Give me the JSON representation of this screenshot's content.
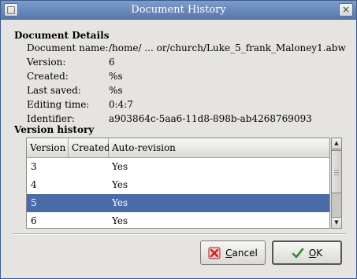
{
  "window": {
    "title": "Document History",
    "left_button": "□",
    "close_button": "×"
  },
  "details": {
    "heading": "Document Details",
    "rows": [
      {
        "label": "Document name:",
        "value": "/home/ ... or/church/Luke_5_frank_Maloney1.abw"
      },
      {
        "label": "Version:",
        "value": "6"
      },
      {
        "label": "Created:",
        "value": "%s"
      },
      {
        "label": "Last saved:",
        "value": "%s"
      },
      {
        "label": "Editing time:",
        "value": "0:4:7"
      },
      {
        "label": "Identifier:",
        "value": "a903864c-5aa6-11d8-898b-ab4268769093"
      }
    ]
  },
  "history": {
    "heading": "Version history",
    "columns": [
      "Version",
      "Created",
      "Auto-revision"
    ],
    "rows": [
      {
        "version": "3",
        "created": "",
        "auto": "Yes",
        "selected": false
      },
      {
        "version": "4",
        "created": "",
        "auto": "Yes",
        "selected": false
      },
      {
        "version": "5",
        "created": "",
        "auto": "Yes",
        "selected": true
      },
      {
        "version": "6",
        "created": "",
        "auto": "Yes",
        "selected": false
      }
    ],
    "scrollbar": {
      "up_icon": "▲",
      "down_icon": "▼"
    }
  },
  "buttons": {
    "cancel": {
      "label": "Cancel",
      "mnemonic_index": 0
    },
    "ok": {
      "label": "OK",
      "mnemonic_index": 0
    }
  },
  "colors": {
    "title_bar": "#5877ad",
    "selection": "#4a6ba8",
    "cancel_icon": "#d02020",
    "ok_icon": "#2e8b2e"
  }
}
